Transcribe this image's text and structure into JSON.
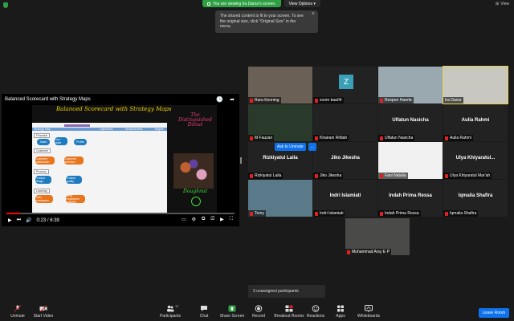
{
  "banner": {
    "sharing_text": "You are viewing Ira Danur's screen.",
    "view_options": "View Options",
    "view_label": "View"
  },
  "tooltip": {
    "text": "The shared content is fit to your screen. To see the original size, click \"Original Size\" in the menu."
  },
  "video": {
    "title": "Balanced Scorecard with Strategy Maps",
    "whiteboard_title": "Balanced Scorecard with Strategy Maps",
    "drawing_title": "The Distinguished Donut",
    "donut_label": "Doughnut",
    "time": "0:23 / 6:39",
    "progress": 0.06,
    "slide": {
      "strategy_map": "Strategy Map",
      "col_objectives": "Objectives",
      "col_measurement": "Measurement",
      "col_targets": "Targets",
      "financial": "Financial",
      "customer": "Customer",
      "process": "Process",
      "learning": "Learning",
      "box_sales": "Sales",
      "box_firm_value": "Firm value",
      "box_profits": "Profits",
      "box_customer_satisfaction": "Customer satisfaction",
      "box_customer_retention": "Customer retention",
      "box_product_design": "Product design",
      "box_product_quality": "Product quality",
      "box_train": "Train employees",
      "box_safe": "Keep employees satisfied"
    }
  },
  "participants": [
    {
      "name": "Rara Kenning",
      "muted": true,
      "kind": "photo",
      "bg": "#6a6055"
    },
    {
      "name": "zoom baa04",
      "muted": true,
      "kind": "avatar",
      "initial": "Z"
    },
    {
      "name": "Respon Harefa",
      "muted": true,
      "kind": "photo",
      "bg": "#9aa8b0"
    },
    {
      "name": "Ira Danur",
      "muted": false,
      "kind": "photo",
      "bg": "#c8c8c0",
      "active": true
    },
    {
      "name": "M Fauzan",
      "muted": true,
      "kind": "photo",
      "bg": "#2a3a2a"
    },
    {
      "name": "Khairani Rifdah",
      "muted": true,
      "kind": "blank"
    },
    {
      "name": "Ulfatun Nasicha",
      "muted": true,
      "kind": "name",
      "display": "Ulfatun Nasicha"
    },
    {
      "name": "Aulia Rahmi",
      "muted": true,
      "kind": "name",
      "display": "Aulia Rahmi"
    },
    {
      "name": "Rizkiyatul Laila",
      "muted": true,
      "kind": "name",
      "display": "Rizkiyatul Laila"
    },
    {
      "name": "Jiko Jikesha",
      "muted": true,
      "kind": "name",
      "display": "Jiko Jikesha"
    },
    {
      "name": "Fani Natalia",
      "muted": true,
      "kind": "photo",
      "bg": "#f0f0f0"
    },
    {
      "name": "Ulya Khiyaratul Mar'ah",
      "muted": true,
      "kind": "name",
      "display": "Ulya  Khiyaratul..."
    },
    {
      "name": "Tomy",
      "muted": true,
      "kind": "photo",
      "bg": "#5a7a8a"
    },
    {
      "name": "Indri Islamiati",
      "muted": true,
      "kind": "name",
      "display": "Indri Islamiati"
    },
    {
      "name": "Indah Prima Ressa",
      "muted": true,
      "kind": "name",
      "display": "Indah Prima Ressa"
    },
    {
      "name": "Iqmalia Shafira",
      "muted": true,
      "kind": "name",
      "display": "Iqmalia Shafira"
    },
    {
      "name": "Muhammad Arsy E P",
      "muted": true,
      "kind": "photo",
      "bg": "#4a4a48"
    }
  ],
  "ask_unmute": "Ask to Unmute",
  "ask_more": "...",
  "unassigned": "3 unassigned participants",
  "toolbar": {
    "unmute": "Unmute",
    "start_video": "Start Video",
    "participants": "Participants",
    "participants_count": "17",
    "chat": "Chat",
    "share_screen": "Share Screen",
    "record": "Record",
    "breakout_rooms": "Breakout Rooms",
    "reactions": "Reactions",
    "apps": "Apps",
    "whiteboards": "Whiteboards",
    "leave_room": "Leave Room"
  },
  "colors": {
    "accent": "#0e72ed",
    "share_green": "#2ea043",
    "active_outline": "#e8d24a",
    "muted_red": "#e02020"
  }
}
